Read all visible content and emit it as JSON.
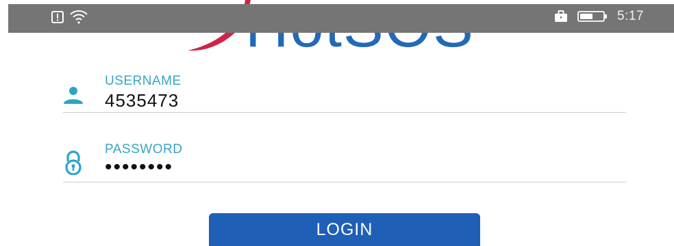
{
  "app": {
    "logo_text": "HotSOS",
    "brand_color": "#2369b7",
    "accent_color": "#cf2447"
  },
  "status_bar": {
    "time": "5:17",
    "icons": [
      "alert-icon",
      "wifi-icon",
      "briefcase-icon",
      "battery-icon"
    ],
    "background": "#757575"
  },
  "form": {
    "username": {
      "label": "USERNAME",
      "value": "4535473",
      "icon": "user-icon"
    },
    "password": {
      "label": "PASSWORD",
      "value": "••••••••",
      "icon": "lock-icon"
    },
    "label_color": "#3aa4c6"
  },
  "login_button": {
    "label": "LOGIN",
    "color": "#1f5fb6"
  }
}
